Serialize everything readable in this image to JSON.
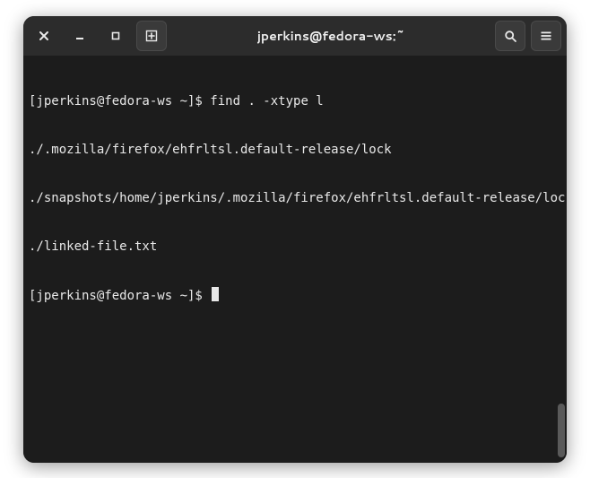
{
  "window": {
    "title": "jperkins@fedora-ws:~"
  },
  "terminal": {
    "prompt1": "[jperkins@fedora-ws ~]$ ",
    "command1": "find . -xtype l",
    "output": [
      "./.mozilla/firefox/ehfrltsl.default-release/lock",
      "./snapshots/home/jperkins/.mozilla/firefox/ehfrltsl.default-release/lock",
      "./linked-file.txt"
    ],
    "prompt2": "[jperkins@fedora-ws ~]$ "
  }
}
